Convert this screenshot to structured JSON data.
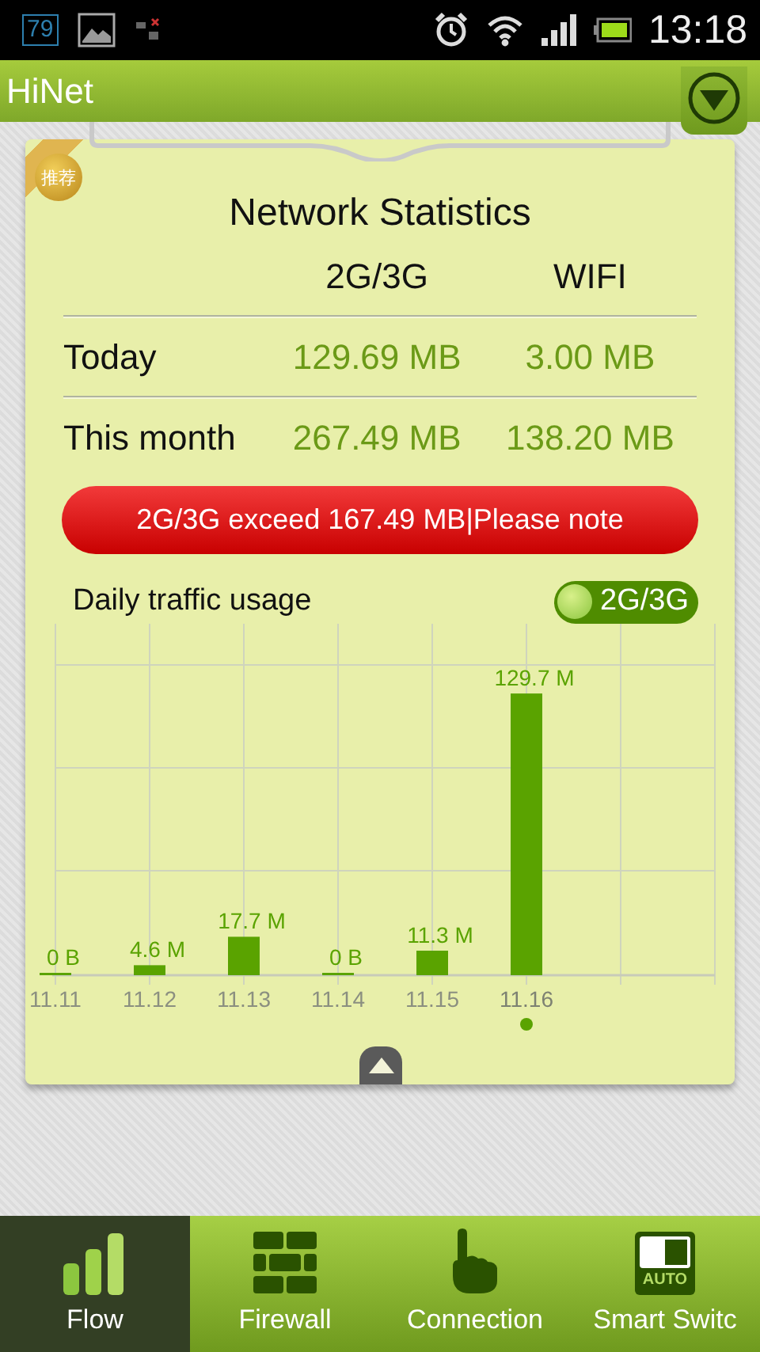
{
  "status_bar": {
    "notification_badge": "79",
    "time": "13:18"
  },
  "app_bar": {
    "title": "HiNet"
  },
  "card": {
    "badge": "推荐",
    "title": "Network Statistics",
    "columns": [
      "2G/3G",
      "WIFI"
    ],
    "rows": [
      {
        "label": "Today",
        "values": [
          "129.69 MB",
          "3.00 MB"
        ]
      },
      {
        "label": "This month",
        "values": [
          "267.49 MB",
          "138.20 MB"
        ]
      }
    ],
    "alert": "2G/3G exceed 167.49 MB|Please note",
    "daily": {
      "title": "Daily traffic usage",
      "toggle": {
        "label": "2G/3G",
        "on": true
      },
      "chart_data": {
        "type": "bar",
        "categories": [
          "11.11",
          "11.12",
          "11.13",
          "11.14",
          "11.15",
          "11.16"
        ],
        "values": [
          0,
          4.6,
          17.7,
          0,
          11.3,
          129.7
        ],
        "data_labels": true,
        "grid": true,
        "value_labels": [
          "0 B",
          "4.6 M",
          "17.7 M",
          "0 B",
          "11.3 M",
          "129.7 M"
        ]
      },
      "days": [
        {
          "selected": false
        },
        {
          "selected": false
        },
        {
          "selected": false
        },
        {
          "selected": false
        },
        {
          "selected": false
        },
        {
          "selected": true
        }
      ]
    }
  },
  "tabs": [
    {
      "label": "Flow",
      "kind": "bars",
      "selected": true
    },
    {
      "label": "Firewall",
      "kind": "wall",
      "selected": false
    },
    {
      "label": "Connection",
      "kind": "hand",
      "selected": false
    },
    {
      "label": "Smart Switc",
      "kind": "switch",
      "icon_text": "AUTO",
      "selected": false
    }
  ]
}
